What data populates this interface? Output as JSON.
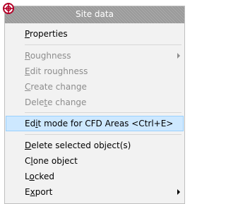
{
  "menu": {
    "header": "Site data",
    "icon": "site-crosshair-icon",
    "accent_colors": {
      "header_bg": "#9a9a9a",
      "highlight_bg": "#cde8ff",
      "highlight_border": "#99d1ff",
      "disabled_text": "#8d8d8d",
      "icon_red": "#b40028"
    },
    "items": [
      {
        "label": "Properties",
        "accel": "P",
        "enabled": true,
        "submenu": false
      },
      {
        "label": "Roughness",
        "accel": "R",
        "enabled": false,
        "submenu": true
      },
      {
        "label": "Edit roughness",
        "accel": "E",
        "enabled": false,
        "submenu": false
      },
      {
        "label": "Create change",
        "accel": "C",
        "enabled": false,
        "submenu": false
      },
      {
        "label": "Delete change",
        "accel": "t",
        "enabled": false,
        "submenu": false
      },
      {
        "label": "Edit mode for CFD Areas <Ctrl+E>",
        "accel": "i",
        "enabled": true,
        "submenu": false,
        "highlighted": true
      },
      {
        "label": "Delete selected object(s)",
        "accel": "D",
        "enabled": true,
        "submenu": false
      },
      {
        "label": "Clone object",
        "accel": "l",
        "enabled": true,
        "submenu": false
      },
      {
        "label": "Locked",
        "accel": "o",
        "enabled": true,
        "submenu": false
      },
      {
        "label": "Export",
        "accel": "x",
        "enabled": true,
        "submenu": true
      }
    ]
  }
}
